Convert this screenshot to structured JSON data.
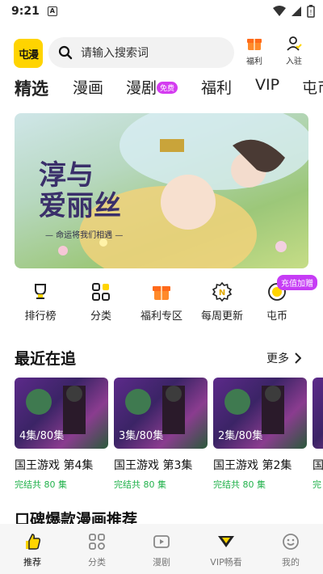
{
  "status_bar": {
    "time": "9:21",
    "notification_icon": "A"
  },
  "header": {
    "logo_text": "屯漫",
    "search_placeholder": "请输入搜索词",
    "welfare_label": "福利",
    "join_label": "入驻"
  },
  "tabs": [
    {
      "label": "精选",
      "active": true
    },
    {
      "label": "漫画"
    },
    {
      "label": "漫剧",
      "badge": "免费"
    },
    {
      "label": "福利"
    },
    {
      "label": "VIP"
    },
    {
      "label": "屯币"
    }
  ],
  "banner": {
    "title_line1": "淳与",
    "title_line2": "爱丽丝",
    "subtitle": "— 命运将我们相遇 —"
  },
  "quick_menu": [
    {
      "label": "排行榜",
      "icon": "trophy-icon"
    },
    {
      "label": "分类",
      "icon": "category-grid-icon"
    },
    {
      "label": "福利专区",
      "icon": "gift-icon"
    },
    {
      "label": "每周更新",
      "icon": "new-badge-icon"
    },
    {
      "label": "屯币",
      "icon": "coin-icon",
      "badge": "充值加赠"
    }
  ],
  "recent": {
    "title": "最近在追",
    "more_label": "更多",
    "items": [
      {
        "episode": "4集/80集",
        "name": "国王游戏 第4集",
        "status": "完结共 80 集"
      },
      {
        "episode": "3集/80集",
        "name": "国王游戏 第3集",
        "status": "完结共 80 集"
      },
      {
        "episode": "2集/80集",
        "name": "国王游戏 第2集",
        "status": "完结共 80 集"
      },
      {
        "episode": "",
        "name": "国",
        "status": "完"
      }
    ]
  },
  "section2_title": "口碑爆款漫画推荐",
  "bottom_nav": [
    {
      "label": "推荐",
      "active": true
    },
    {
      "label": "分类"
    },
    {
      "label": "漫剧"
    },
    {
      "label": "VIP畅看"
    },
    {
      "label": "我的"
    }
  ],
  "colors": {
    "accent": "#ffd400",
    "badge_purple": "#d43cf0",
    "status_green": "#22b24c"
  }
}
